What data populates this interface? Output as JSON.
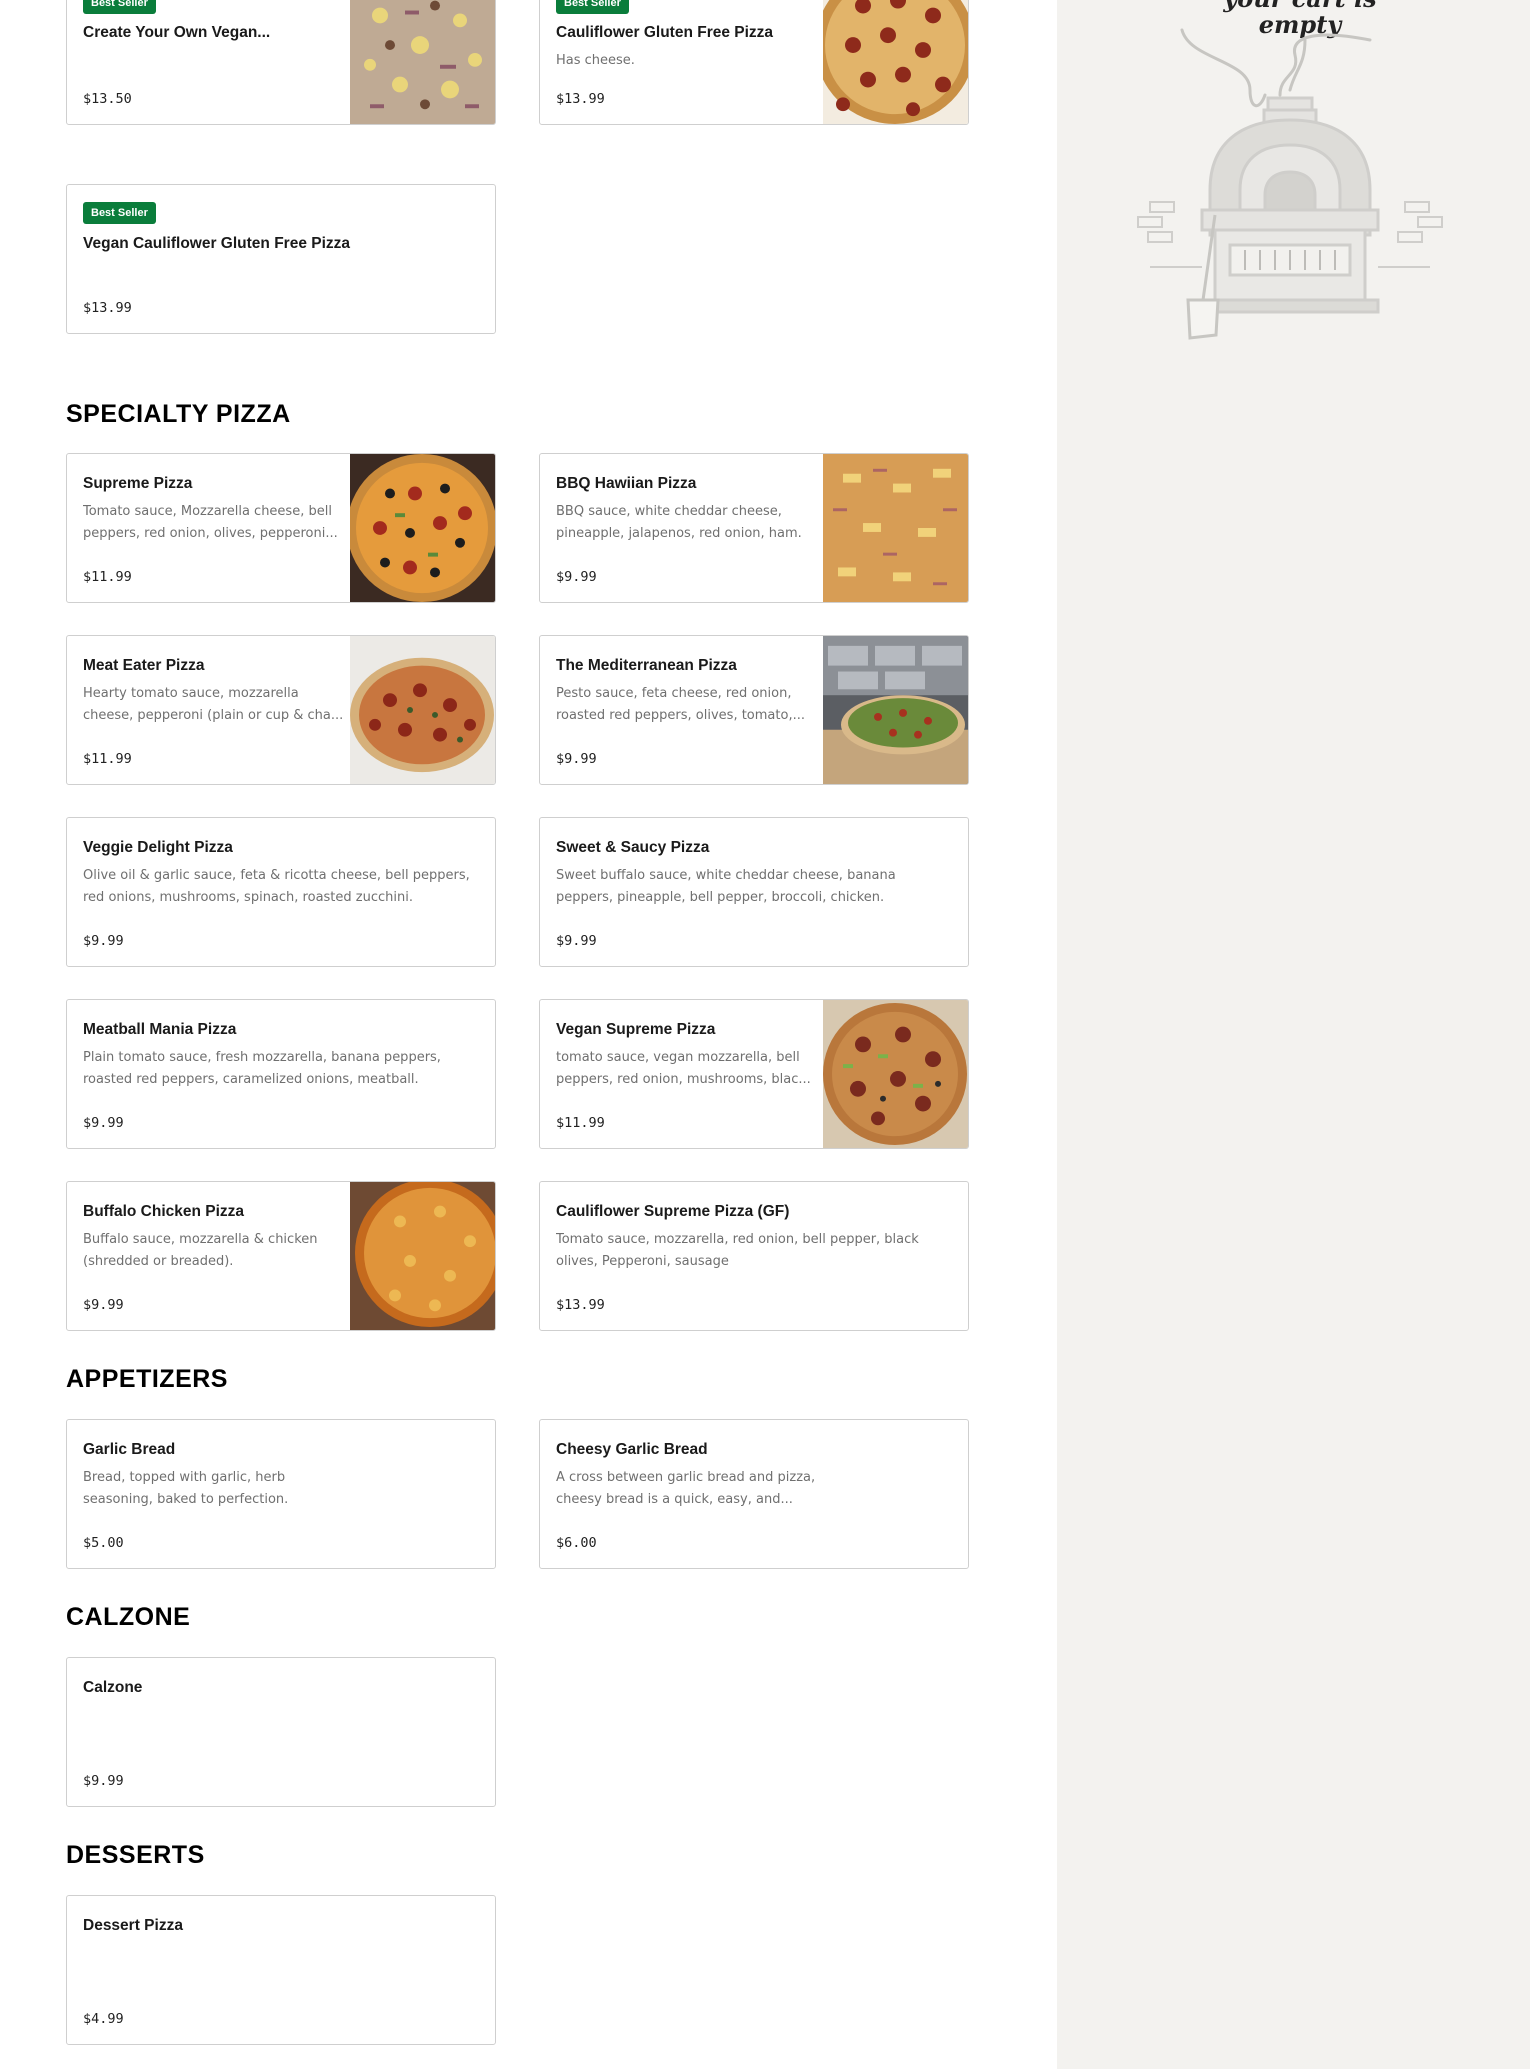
{
  "cart": {
    "empty_text": "your cart is empty"
  },
  "sections": {
    "gluten_free": {
      "items": [
        {
          "name": "Create Your Own Vegan...",
          "desc": "",
          "price": "$13.50",
          "badge": "Best Seller"
        },
        {
          "name": "Cauliflower Gluten Free Pizza",
          "desc": "Has cheese.",
          "price": "$13.99",
          "badge": "Best Seller"
        },
        {
          "name": "Vegan Cauliflower Gluten Free Pizza",
          "desc": "",
          "price": "$13.99",
          "badge": "Best Seller"
        }
      ]
    },
    "specialty": {
      "title": "SPECIALTY PIZZA",
      "items": [
        {
          "name": "Supreme Pizza",
          "desc": "Tomato sauce, Mozzarella cheese, bell peppers, red onion, olives, pepperoni...",
          "price": "$11.99"
        },
        {
          "name": "BBQ Hawiian Pizza",
          "desc": "BBQ sauce, white cheddar cheese, pineapple, jalapenos, red onion, ham.",
          "price": "$9.99"
        },
        {
          "name": "Meat Eater Pizza",
          "desc": "Hearty tomato sauce, mozzarella cheese, pepperoni (plain or cup & cha...",
          "price": "$11.99"
        },
        {
          "name": "The Mediterranean Pizza",
          "desc": "Pesto sauce, feta cheese, red onion, roasted red peppers, olives, tomato,...",
          "price": "$9.99"
        },
        {
          "name": "Veggie Delight Pizza",
          "desc": "Olive oil & garlic sauce, feta & ricotta cheese, bell peppers, red onions, mushrooms, spinach, roasted zucchini.",
          "price": "$9.99"
        },
        {
          "name": "Sweet & Saucy Pizza",
          "desc": "Sweet buffalo sauce, white cheddar cheese, banana peppers, pineapple, bell pepper, broccoli, chicken.",
          "price": "$9.99"
        },
        {
          "name": "Meatball Mania Pizza",
          "desc": "Plain tomato sauce, fresh mozzarella, banana peppers, roasted red peppers, caramelized onions, meatball.",
          "price": "$9.99"
        },
        {
          "name": "Vegan Supreme Pizza",
          "desc": "tomato sauce, vegan mozzarella, bell peppers, red onion, mushrooms, blac...",
          "price": "$11.99"
        },
        {
          "name": "Buffalo Chicken Pizza",
          "desc": "Buffalo sauce, mozzarella & chicken (shredded or breaded).",
          "price": "$9.99"
        },
        {
          "name": "Cauliflower Supreme Pizza (GF)",
          "desc": "Tomato sauce, mozzarella, red onion, bell pepper, black olives, Pepperoni, sausage",
          "price": "$13.99"
        }
      ]
    },
    "appetizers": {
      "title": "APPETIZERS",
      "items": [
        {
          "name": "Garlic Bread",
          "desc": "Bread, topped with garlic, herb seasoning, baked to perfection.",
          "price": "$5.00"
        },
        {
          "name": "Cheesy Garlic Bread",
          "desc": "A cross between garlic bread and pizza, cheesy bread is a quick, easy, and...",
          "price": "$6.00"
        }
      ]
    },
    "calzone": {
      "title": "CALZONE",
      "items": [
        {
          "name": "Calzone",
          "desc": "",
          "price": "$9.99"
        }
      ]
    },
    "desserts": {
      "title": "DESSERTS",
      "items": [
        {
          "name": "Dessert Pizza",
          "desc": "",
          "price": "$4.99"
        }
      ]
    }
  },
  "colors": {
    "badge": "#0a7d3b",
    "cart_bg": "#f3f2ef",
    "border": "#cfcfcf"
  }
}
